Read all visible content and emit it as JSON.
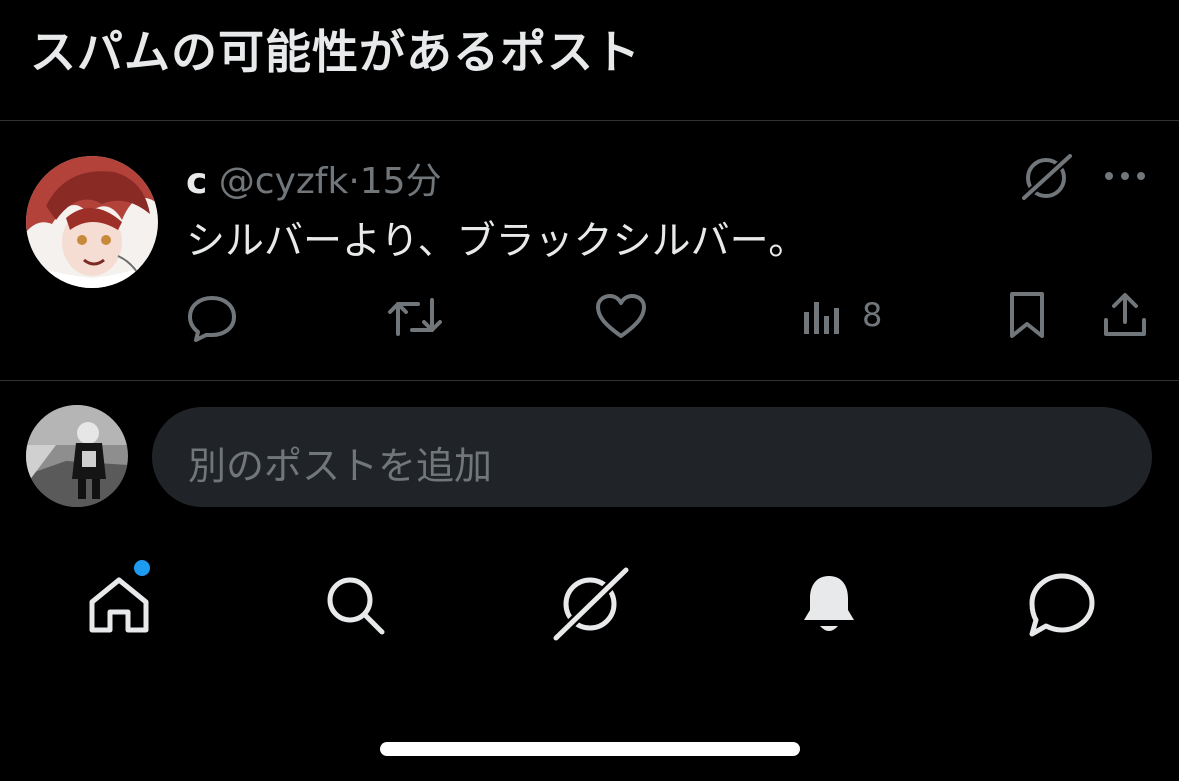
{
  "header": {
    "title": "スパムの可能性があるポスト"
  },
  "post": {
    "author_name": "c",
    "handle": "@cyzfk",
    "separator": "·",
    "time": "15分",
    "text": "シルバーより、ブラックシルバー。",
    "views_count": "8",
    "icons": [
      "grok-icon",
      "more-icon",
      "reply-icon",
      "repost-icon",
      "like-icon",
      "views-icon",
      "bookmark-icon",
      "share-icon"
    ]
  },
  "composer": {
    "placeholder": "別のポストを追加"
  },
  "tabbar": {
    "items": [
      "home-icon",
      "search-icon",
      "grok-icon",
      "notifications-icon",
      "messages-icon"
    ],
    "home_has_badge": true
  },
  "colors": {
    "background": "#000000",
    "text": "#e7e9ea",
    "secondary": "#71767b",
    "accent": "#1d9bf0",
    "input_bg": "#202327"
  }
}
